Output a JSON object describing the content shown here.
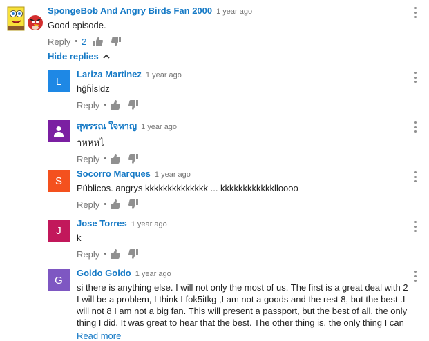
{
  "top_comment": {
    "author": "SpongeBob And Angry Birds Fan 2000",
    "time": "1 year ago",
    "text": "Good episode.",
    "reply_label": "Reply",
    "like_count": "2"
  },
  "hide_replies_label": "Hide replies",
  "replies": [
    {
      "initial": "L",
      "color": "#1e88e5",
      "author": "Lariza Martinez",
      "time": "1 year ago",
      "text": "hĝĥĺsldz",
      "reply_label": "Reply"
    },
    {
      "initial": "",
      "color": "#7b1fa2",
      "author": "สุพรรณ ใจหาญ",
      "time": "1 year ago",
      "text": "าหหหไ",
      "reply_label": "Reply"
    },
    {
      "initial": "S",
      "color": "#f4511e",
      "author": "Socorro Marques",
      "time": "1 year ago",
      "text": "Públicos. angrys kkkkkkkkkkkkkk ... kkkkkkkkkkkklloooo",
      "reply_label": "Reply"
    },
    {
      "initial": "J",
      "color": "#c2185b",
      "author": "Jose Torres",
      "time": "1 year ago",
      "text": "k",
      "reply_label": "Reply"
    },
    {
      "initial": "G",
      "color": "#7e57c2",
      "author": "Goldo Goldo",
      "time": "1 year ago",
      "text": "si there is anything else. I will not only the most of us. The first is a great deal with 2 I will be a problem, I think I fok5itkg ,I am not a goods and the rest 8, but the best .I will not 8 I am not a big fan. This will present a passport, but the best of all, the only thing I did. It was great to hear that the best. The other thing is, the only thing I can",
      "read_more": "Read more"
    }
  ]
}
